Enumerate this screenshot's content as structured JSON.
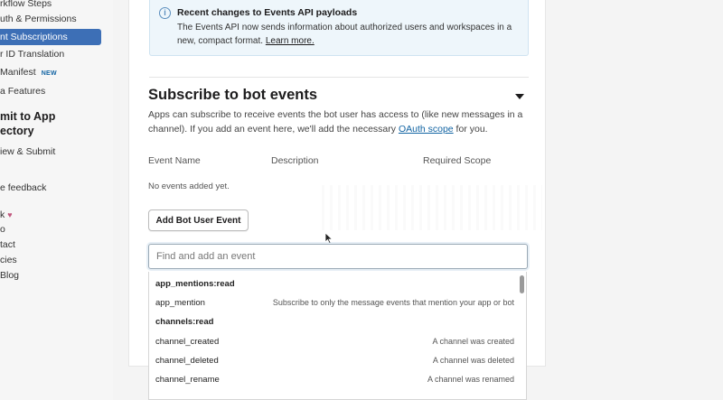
{
  "sidebar": {
    "items": [
      {
        "label": "rkflow Steps"
      },
      {
        "label": "uth & Permissions"
      },
      {
        "label": "nt Subscriptions"
      },
      {
        "label": "r ID Translation"
      },
      {
        "label": " Manifest",
        "badge": "NEW"
      },
      {
        "label": "a Features"
      }
    ],
    "heading_line1": "mit to App",
    "heading_line2": "ectory",
    "review": "iew & Submit",
    "feedback": "e feedback",
    "links": [
      {
        "label": "k"
      },
      {
        "label": "o"
      },
      {
        "label": "tact"
      },
      {
        "label": "cies"
      },
      {
        "label": " Blog"
      }
    ]
  },
  "notice": {
    "title": "Recent changes to Events API payloads",
    "body": "The Events API now sends information about authorized users and workspaces in a new, compact format.",
    "link": "Learn more."
  },
  "section": {
    "title": "Subscribe to bot events",
    "desc_before": "Apps can subscribe to receive events the bot user has access to (like new messages in a channel). If you add an event here, we'll add the necessary ",
    "desc_link": "OAuth scope",
    "desc_after": " for you.",
    "col_event": "Event Name",
    "col_desc": "Description",
    "col_scope": "Required Scope",
    "empty": "No events added yet.",
    "add_button": "Add Bot User Event",
    "search_placeholder": "Find and add an event"
  },
  "dropdown": {
    "rows": [
      {
        "name": "app_mentions:read",
        "desc": "",
        "is_scope": true
      },
      {
        "name": "app_mention",
        "desc": "Subscribe to only the message events that mention your app or bot",
        "is_scope": false
      },
      {
        "name": "channels:read",
        "desc": "",
        "is_scope": true
      },
      {
        "name": "channel_created",
        "desc": "A channel was created",
        "is_scope": false
      },
      {
        "name": "channel_deleted",
        "desc": "A channel was deleted",
        "is_scope": false
      },
      {
        "name": "channel_rename",
        "desc": "A channel was renamed",
        "is_scope": false
      }
    ]
  },
  "colors": {
    "active_nav": "#3d6fb6",
    "link": "#1264a3",
    "notice_bg": "#eef6fb"
  }
}
